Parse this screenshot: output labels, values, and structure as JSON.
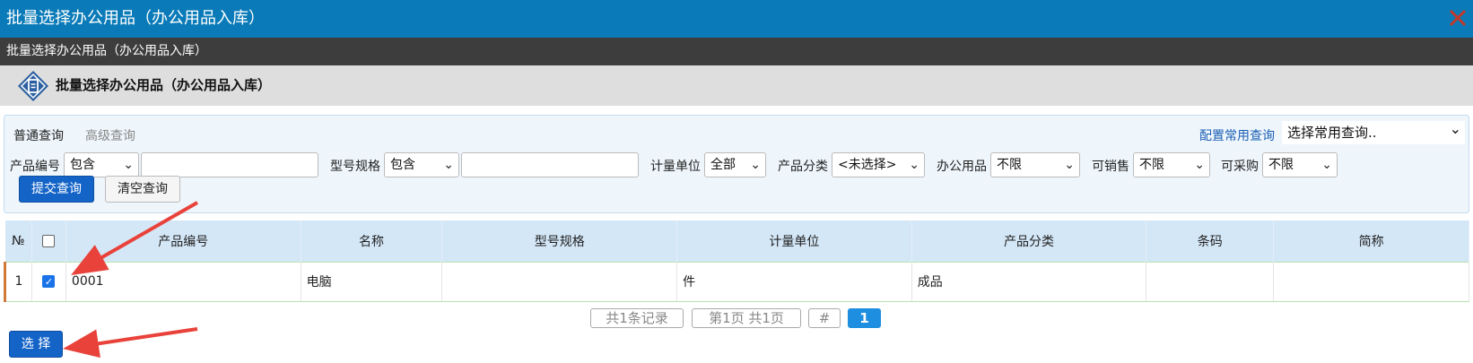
{
  "window": {
    "title": "批量选择办公用品（办公用品入库）"
  },
  "subbar": {
    "title": "批量选择办公用品（办公用品入库）"
  },
  "header": {
    "title": "批量选择办公用品（办公用品入库）"
  },
  "query": {
    "tabs": [
      "普通查询",
      "高级查询"
    ],
    "config_link": "配置常用查询",
    "common_select": "选择常用查询..",
    "fields": {
      "product_no_label": "产品编号",
      "product_no_op": "包含",
      "product_no_value": "",
      "model_label": "型号规格",
      "model_op": "包含",
      "model_value": "",
      "unit_label": "计量单位",
      "unit_value": "全部",
      "category_label": "产品分类",
      "category_value": "<未选择>",
      "office_label": "办公用品",
      "office_value": "不限",
      "salable_label": "可销售",
      "salable_value": "不限",
      "purchasable_label": "可采购",
      "purchasable_value": "不限"
    },
    "submit_label": "提交查询",
    "clear_label": "清空查询"
  },
  "table": {
    "headers": [
      "№",
      "",
      "产品编号",
      "名称",
      "型号规格",
      "计量单位",
      "产品分类",
      "条码",
      "简称"
    ],
    "rows": [
      {
        "no": "1",
        "checked": true,
        "code": "0001",
        "name": "电脑",
        "model": "",
        "unit": "件",
        "category": "成品",
        "barcode": "",
        "short": ""
      }
    ]
  },
  "pager": {
    "records": "共1条记录",
    "pages": "第1页 共1页",
    "hash": "#",
    "current": "1"
  },
  "footer": {
    "select_label": "选 择"
  },
  "colors": {
    "titlebar": "#0a7bb8",
    "subbar": "#3d3d3d",
    "button": "#1464c8",
    "table_header": "#d4e7f7",
    "arrow": "#e8423a"
  }
}
